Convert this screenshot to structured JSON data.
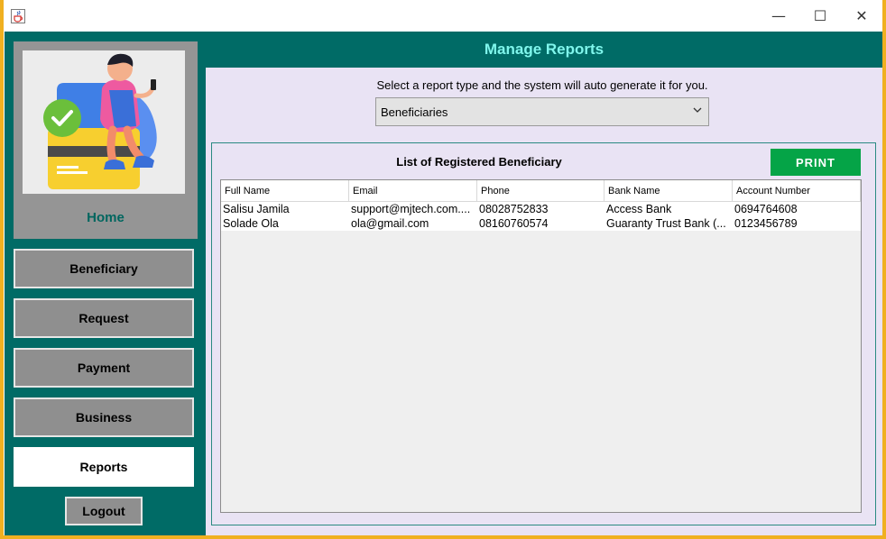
{
  "window": {
    "title": "",
    "controls": {
      "minimize": "—",
      "maximize": "☐",
      "close": "✕"
    }
  },
  "sidebar": {
    "home_label": "Home",
    "nav": [
      {
        "label": "Beneficiary",
        "active": false
      },
      {
        "label": "Request",
        "active": false
      },
      {
        "label": "Payment",
        "active": false
      },
      {
        "label": "Business",
        "active": false
      },
      {
        "label": "Reports",
        "active": true
      }
    ],
    "logout_label": "Logout"
  },
  "main": {
    "header_title": "Manage Reports",
    "hint": "Select a report type and the system will auto generate it for you.",
    "report_type": "Beneficiaries",
    "list_title": "List of Registered Beneficiary",
    "print_label": "PRINT",
    "table": {
      "columns": [
        "Full Name",
        "Email",
        "Phone",
        "Bank Name",
        "Account Number"
      ],
      "rows": [
        [
          "Salisu Jamila",
          "support@mjtech.com....",
          "08028752833",
          "Access Bank",
          "0694764608"
        ],
        [
          "Solade Ola",
          "ola@gmail.com",
          "08160760574",
          "Guaranty Trust Bank (...",
          "0123456789"
        ]
      ]
    }
  },
  "colors": {
    "teal": "#006b66",
    "header_text": "#7ff6ec",
    "panel_bg": "#e9e3f4",
    "nav_button": "#8f8f8f",
    "print_green": "#05a447"
  },
  "icons": {
    "app": "java-cup-icon",
    "dropdown": "chevron-down-icon",
    "illustration": "person-on-credit-card-illustration"
  }
}
